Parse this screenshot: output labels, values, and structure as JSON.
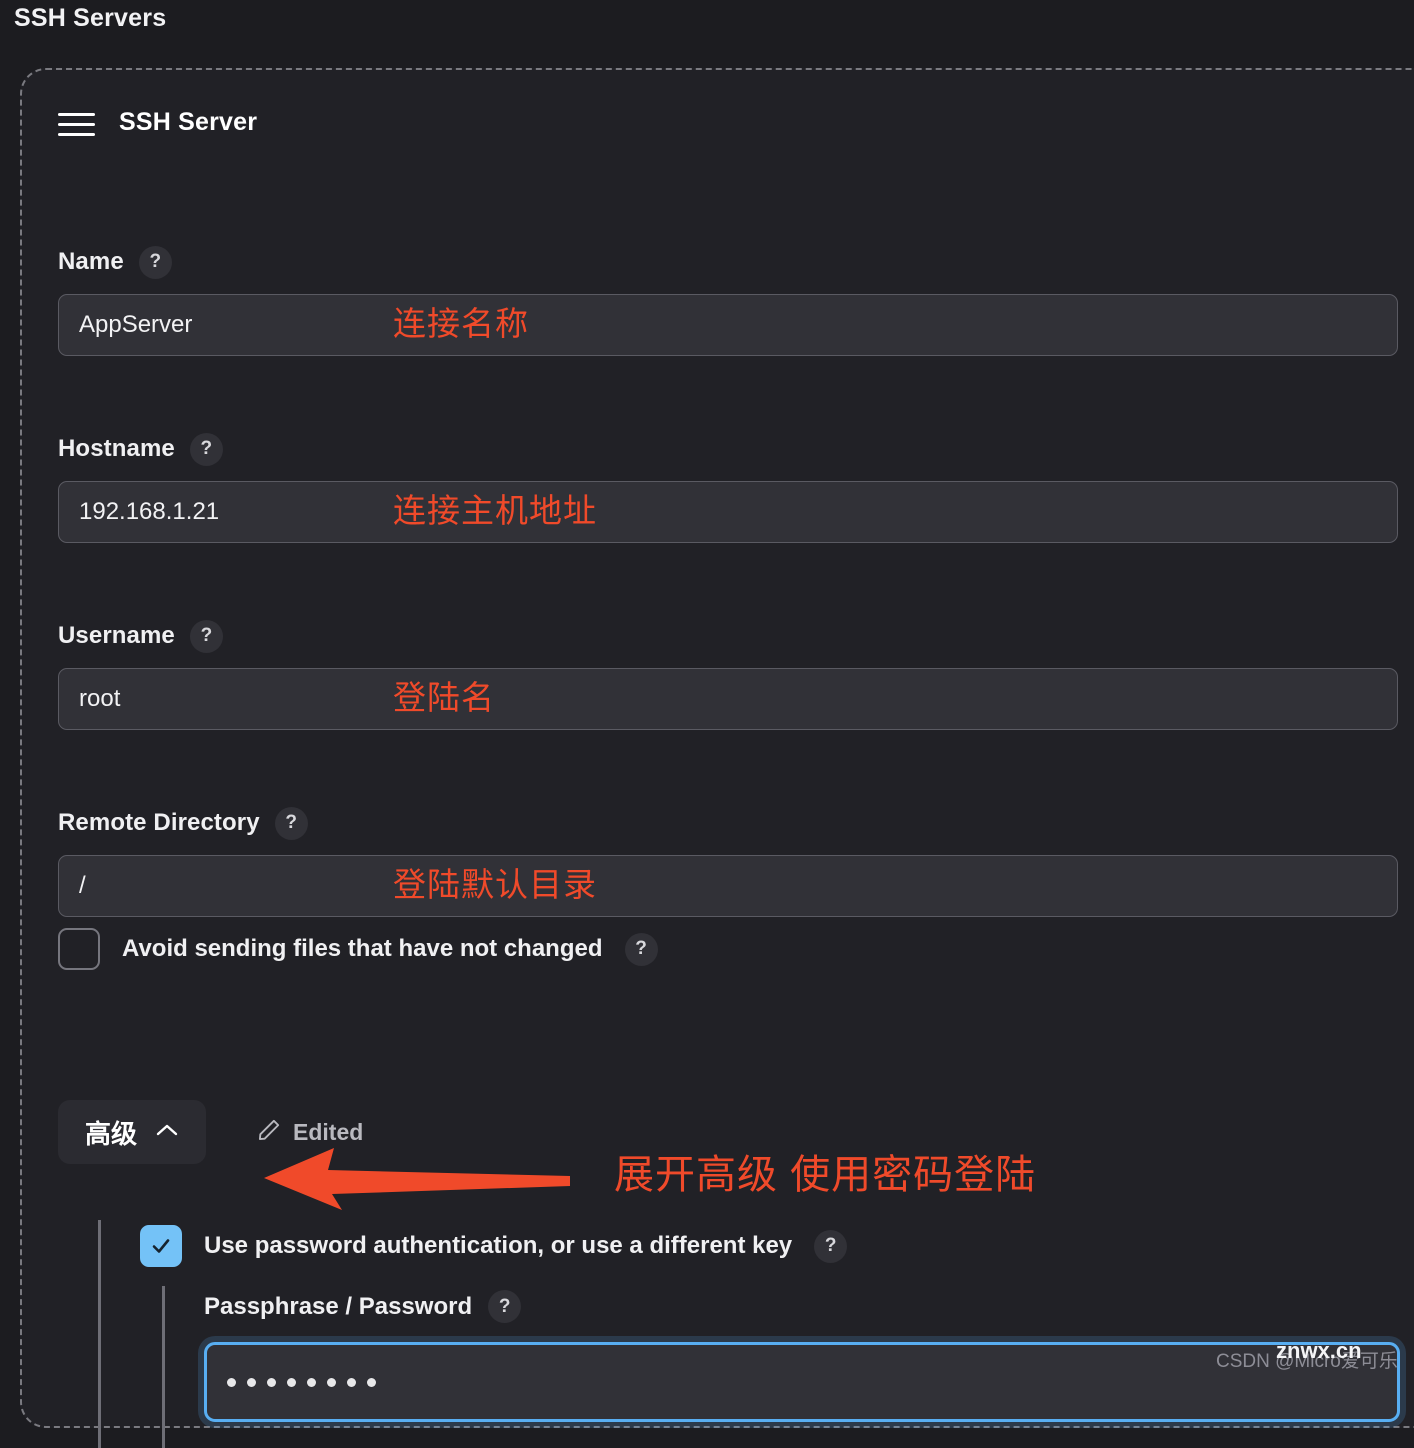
{
  "page": {
    "title": "SSH Servers"
  },
  "card": {
    "title": "SSH Server",
    "menu_icon": "hamburger-menu-icon",
    "help_glyph": "?"
  },
  "fields": [
    {
      "label": "Name",
      "value": "AppServer",
      "annotation": "连接名称"
    },
    {
      "label": "Hostname",
      "value": "192.168.1.21",
      "annotation": "连接主机地址"
    },
    {
      "label": "Username",
      "value": "root",
      "annotation": "登陆名"
    },
    {
      "label": "Remote Directory",
      "value": "/",
      "annotation": "登陆默认目录"
    }
  ],
  "avoid_sending": {
    "label": "Avoid sending files that have not changed",
    "checked": false
  },
  "advanced": {
    "button_label": "高级",
    "chevron_icon": "chevron-up-icon",
    "pencil_icon": "pencil-icon",
    "edited_label": "Edited",
    "annotation": "展开高级 使用密码登陆",
    "arrow_icon": "left-arrow-icon",
    "arrow_color": "#f04a2a"
  },
  "password_auth": {
    "label": "Use password authentication, or use a different key",
    "checked": true,
    "checkbox_color": "#74c2f7"
  },
  "passphrase": {
    "label": "Passphrase / Password",
    "value": "••••••••",
    "dot_count": 8,
    "focus_color": "#58aef2"
  },
  "watermarks": {
    "csdn": "CSDN @Micro爱可乐",
    "site": "znwx.cn"
  }
}
